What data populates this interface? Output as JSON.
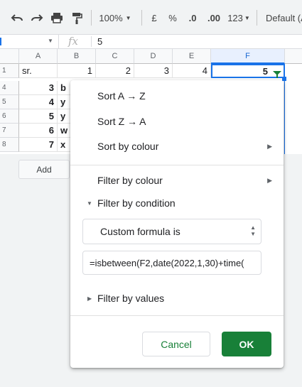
{
  "toolbar": {
    "zoom": "100%",
    "currency": "£",
    "percent": "%",
    "decrease_decimals": ".0",
    "increase_decimals": ".00",
    "more_formats": "123",
    "font": "Default (A"
  },
  "formula_bar": {
    "fx": "fx",
    "value": "5"
  },
  "grid": {
    "columns": [
      "A",
      "B",
      "C",
      "D",
      "E",
      "F"
    ],
    "rows": [
      {
        "num": "1",
        "a": "sr.",
        "b": "1",
        "c": "2",
        "d": "3",
        "e": "4",
        "f": "5"
      },
      {
        "num": "4",
        "a": "3",
        "b": "b"
      },
      {
        "num": "5",
        "a": "4",
        "b": "y"
      },
      {
        "num": "6",
        "a": "5",
        "b": "y"
      },
      {
        "num": "7",
        "a": "6",
        "b": "w"
      },
      {
        "num": "8",
        "a": "7",
        "b": "x"
      }
    ],
    "add_button": "Add"
  },
  "menu": {
    "sort_az": "Sort A → Z",
    "sort_za": "Sort Z → A",
    "sort_colour": "Sort by colour",
    "filter_colour": "Filter by colour",
    "filter_condition": "Filter by condition",
    "condition_select": "Custom formula is",
    "formula_input": "=isbetween(F2,date(2022,1,30)+time(",
    "filter_values": "Filter by values",
    "cancel": "Cancel",
    "ok": "OK"
  },
  "colors": {
    "accent_green": "#188038",
    "selection_blue": "#1a73e8"
  }
}
